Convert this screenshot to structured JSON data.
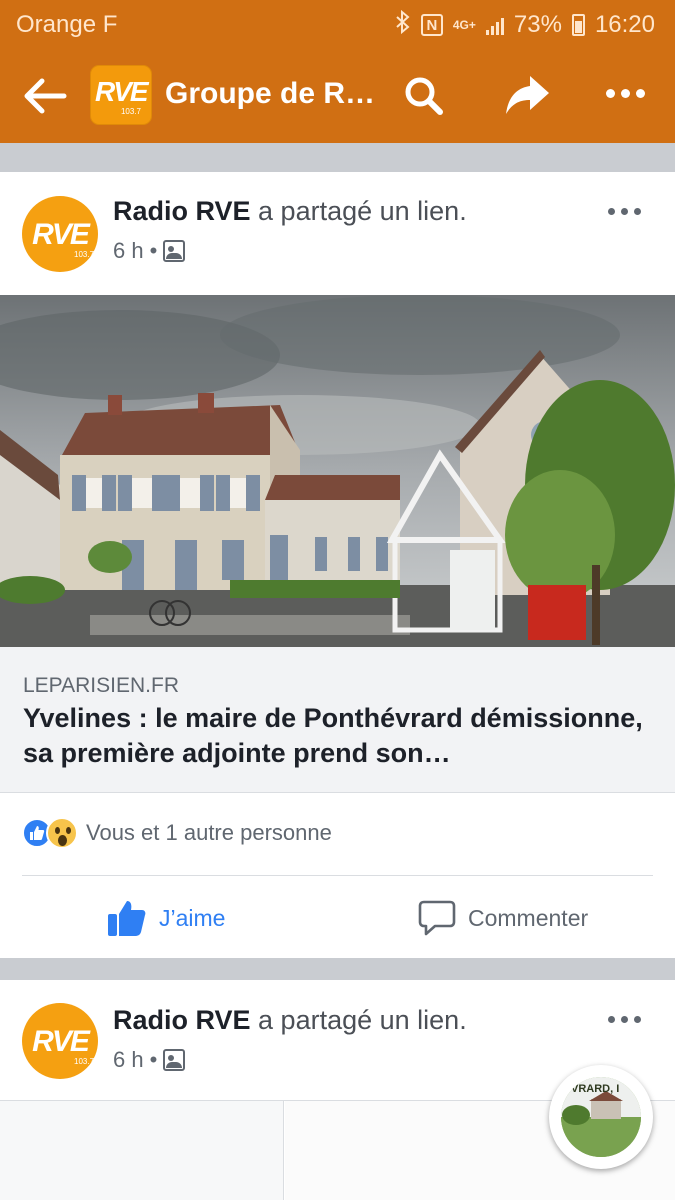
{
  "status_bar": {
    "carrier": "Orange F",
    "network": "4G+",
    "battery": "73%",
    "time": "16:20",
    "icons": [
      "bluetooth-icon",
      "nfc-icon",
      "signal-icon",
      "battery-icon"
    ]
  },
  "app_bar": {
    "logo_text": "RVE",
    "logo_sub": "103.7",
    "title": "Groupe de R…",
    "icons": [
      "back-arrow-icon",
      "search-icon",
      "share-icon",
      "more-icon"
    ]
  },
  "post1": {
    "avatar_text": "RVE",
    "avatar_sub": "103.7",
    "author": "Radio RVE",
    "action": " a partagé un lien.",
    "time": "6 h",
    "separator": "•",
    "link": {
      "domain": "LEPARISIEN.FR",
      "title": "Yvelines : le maire de Ponthévrard démissionne, sa première adjointe prend son…"
    },
    "reactions_text": "Vous et 1 autre personne",
    "like_label": "J’aime",
    "comment_label": "Commenter"
  },
  "post2": {
    "avatar_text": "RVE",
    "avatar_sub": "103.7",
    "author": "Radio RVE",
    "action": " a partagé un lien.",
    "time": "6 h",
    "separator": "•"
  },
  "fab": {
    "label": "VRARD, I"
  },
  "colors": {
    "brand_orange": "#d06f13",
    "facebook_blue": "#2f7ff3",
    "text_dark": "#1d2129",
    "text_gray": "#606770"
  }
}
